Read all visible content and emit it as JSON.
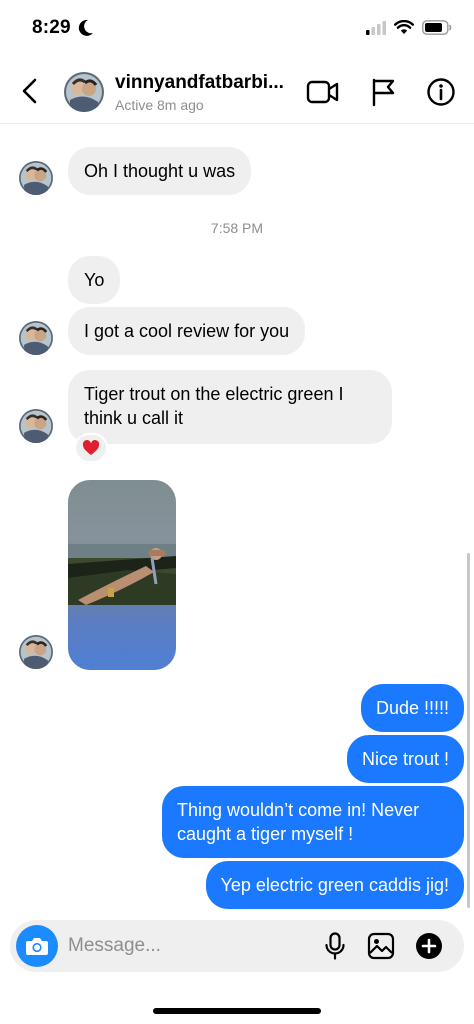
{
  "status_bar": {
    "time": "8:29",
    "icons": [
      "moon-icon",
      "cellular-signal-icon",
      "wifi-icon",
      "battery-icon"
    ]
  },
  "header": {
    "username": "vinnyandfatbarbi...",
    "active_status": "Active 8m ago",
    "icons": [
      "back-chevron-icon",
      "video-call-icon",
      "flag-icon",
      "info-icon"
    ]
  },
  "thread": {
    "messages_before_time": [
      {
        "sender": "them",
        "text": "Oh I thought u was"
      }
    ],
    "timestamp": "7:58 PM",
    "messages_after_time": [
      {
        "sender": "them",
        "text": "Yo"
      },
      {
        "sender": "them",
        "text": "I got a cool review for you"
      },
      {
        "sender": "them",
        "text": "Tiger trout on the electric green I think u call it",
        "reaction": "heart"
      },
      {
        "sender": "them",
        "type": "video"
      },
      {
        "sender": "me",
        "text": "Dude !!!!!"
      },
      {
        "sender": "me",
        "text": "Nice trout !"
      },
      {
        "sender": "me",
        "text": "Thing wouldn’t come in! Never caught a tiger myself !"
      },
      {
        "sender": "me",
        "text": "Yep electric green caddis jig!"
      }
    ]
  },
  "composer": {
    "placeholder": "Message...",
    "icons": [
      "camera-icon",
      "microphone-icon",
      "gallery-icon",
      "add-icon"
    ]
  },
  "colors": {
    "outgoing_bubble": "#1a79ff",
    "incoming_bubble": "#efefef",
    "camera_button": "#1a8cff",
    "reaction_heart": "#e0202f"
  }
}
